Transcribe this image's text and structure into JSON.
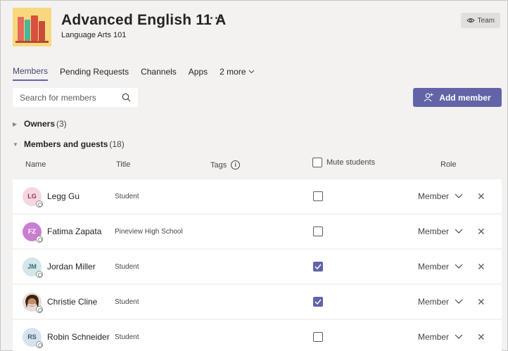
{
  "team": {
    "name": "Advanced English 11 A",
    "more": "···",
    "subtitle": "Language Arts 101",
    "badge": "Team"
  },
  "tabs": [
    {
      "label": "Members",
      "active": true
    },
    {
      "label": "Pending Requests"
    },
    {
      "label": "Channels"
    },
    {
      "label": "Apps"
    },
    {
      "label": "2 more"
    }
  ],
  "search": {
    "placeholder": "Search for members"
  },
  "add_member_label": "Add member",
  "owners": {
    "label": "Owners",
    "count": "(3)"
  },
  "members_section": {
    "label": "Members and guests",
    "count": "(18)"
  },
  "columns": {
    "name": "Name",
    "title": "Title",
    "tags": "Tags",
    "mute": "Mute students",
    "role": "Role"
  },
  "members": [
    {
      "initials": "LG",
      "name": "Legg Gu",
      "title": "Student",
      "muted": false,
      "role": "Member",
      "avatar_bg": "#f5d7e2",
      "avatar_fg": "#8b3a5a"
    },
    {
      "initials": "FZ",
      "name": "Fatima Zapata",
      "title": "Pineview High School",
      "muted": false,
      "role": "Member",
      "avatar_bg": "#c97ed1",
      "avatar_fg": "#ffffff"
    },
    {
      "initials": "JM",
      "name": "Jordan Miller",
      "title": "Student",
      "muted": true,
      "role": "Member",
      "avatar_bg": "#d3e6ea",
      "avatar_fg": "#3b6873"
    },
    {
      "initials": "",
      "name": "Christie Cline",
      "title": "Student",
      "muted": true,
      "role": "Member",
      "avatar_bg": "#7a4a3a",
      "avatar_fg": "#ffffff"
    },
    {
      "initials": "RS",
      "name": "Robin Schneider",
      "title": "Student",
      "muted": false,
      "role": "Member",
      "avatar_bg": "#d6e3ef",
      "avatar_fg": "#3b5573"
    }
  ],
  "colors": {
    "accent": "#6264a7",
    "background": "#f3f2f1"
  }
}
